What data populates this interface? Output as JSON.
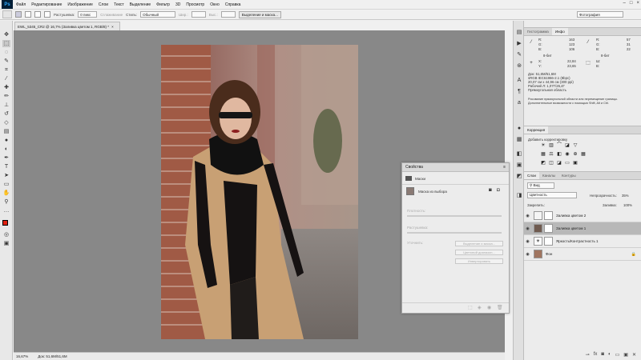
{
  "app": {
    "logo": "Ps"
  },
  "menu": [
    "Файл",
    "Редактирование",
    "Изображение",
    "Слои",
    "Текст",
    "Выделение",
    "Фильтр",
    "3D",
    "Просмотр",
    "Окно",
    "Справка"
  ],
  "window_controls": [
    "–",
    "□",
    "×"
  ],
  "options": {
    "feather_label": "Растушевка:",
    "feather_value": "0 пикс",
    "antialias_label": "Сглаживание",
    "style_label": "Стиль:",
    "style_value": "Обычный",
    "width_label": "Шир.:",
    "height_label": "Выс.:",
    "select_mask_button": "Выделение и маска...",
    "workspace": "Фотография"
  },
  "document": {
    "tab_title": "EWL_5345_CR2 @ 16,7% (Заливка цветом 1, RGB/8) *",
    "close": "×",
    "zoom": "16,67%",
    "doc_size": "Док: 51,6M/51,6M"
  },
  "properties": {
    "title": "Свойства",
    "section": "Маски",
    "mask_label": "Маска из выбора",
    "density_label": "Плотность:",
    "feather_label": "Растушевка:",
    "refine_label": "Уточнить:",
    "btn_select_mask": "Выделение и маска...",
    "btn_color_range": "Цветовой диапазон...",
    "btn_invert": "Инвертировать"
  },
  "panels": {
    "top_tabs": [
      "Гистограмма",
      "Инфо"
    ],
    "info": {
      "r_label": "R:",
      "g_label": "G:",
      "b_label": "B:",
      "r1": "163",
      "g1": "123",
      "b1": "106",
      "r2": "57",
      "g2": "31",
      "b2": "22",
      "bit1": "8-бит",
      "bit2": "8-бит",
      "x_label": "X:",
      "y_label": "Y:",
      "x_val": "22,84",
      "y_val": "23,65",
      "w_label": "Ш:",
      "h_label": "В:",
      "doc_line": "Док: 51,6M/51,6M",
      "profile_line": "sRGB IEC61966-2.1 (8bpc)",
      "dims_line": "20,07 см x 44,96 см (300 ppi)",
      "work_line": "Рабочий Л: 1,07Г/26,4Г",
      "rect_line": "Прямоугольная область",
      "hint1": "Рисование прямоугольной области или перемещение границы.",
      "hint2": "Дополнительные возможности с помощью Shift, Alt и Ctrl."
    },
    "corrections_tab": "Коррекция",
    "add_adjustment": "Добавить корректировку",
    "layers_tabs": [
      "Слои",
      "Каналы",
      "Контуры"
    ],
    "kind_filter": "Вид",
    "blend_mode": "Цветность",
    "opacity_label": "Непрозрачность:",
    "opacity_value": "35%",
    "lock_label": "Закрепить:",
    "fill_label": "Заливка:",
    "fill_value": "100%",
    "layers": [
      {
        "name": "Заливка цветом 2",
        "thumb": "#ffffff",
        "selected": false
      },
      {
        "name": "Заливка цветом 1",
        "thumb": "#6f5a4f",
        "selected": true
      },
      {
        "name": "Яркость/Контрастность 1",
        "thumb": "#ffffff",
        "selected": false
      },
      {
        "name": "Фон",
        "thumb": "#a07560",
        "selected": false
      }
    ],
    "footer_icons": [
      "link-icon",
      "fx-icon",
      "mask-icon",
      "adjustment-icon",
      "folder-icon",
      "new-layer-icon",
      "trash-icon"
    ]
  }
}
